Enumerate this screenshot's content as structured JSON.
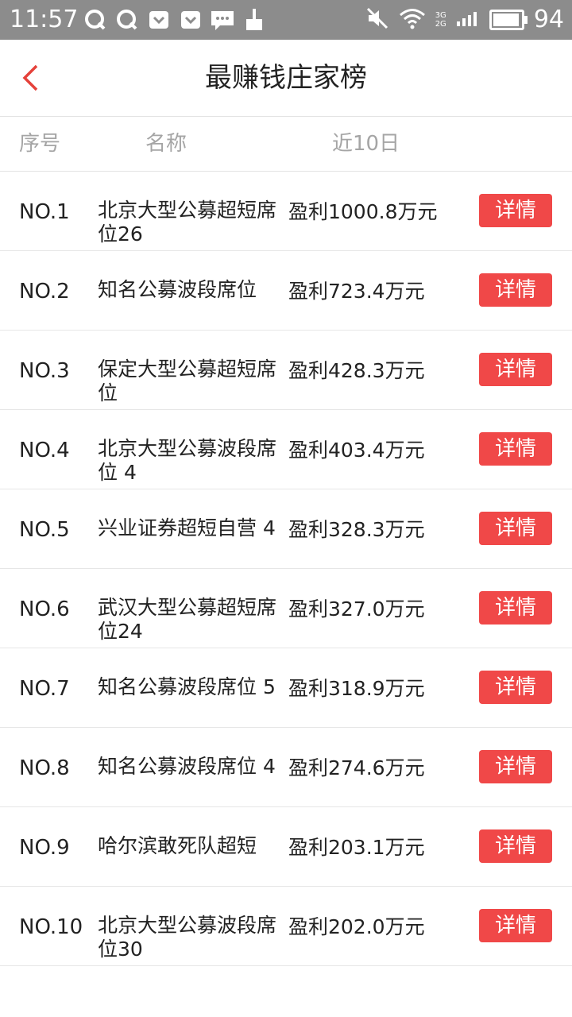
{
  "status_bar": {
    "time": "11:57",
    "battery": "94",
    "icons": [
      "q-app-icon",
      "q-app-icon",
      "pocket-icon",
      "pocket-icon",
      "message-icon",
      "broom-icon"
    ],
    "right_icons": [
      "mute-icon",
      "wifi-icon",
      "signal-icon",
      "battery-icon"
    ],
    "signal_labels": [
      "3G",
      "2G"
    ]
  },
  "header": {
    "title": "最赚钱庄家榜",
    "back_icon": "back-chevron-icon",
    "accent_color": "#e5413a"
  },
  "columns": {
    "rank": "序号",
    "name": "名称",
    "profit": "近10日"
  },
  "rows": [
    {
      "rank": "NO.1",
      "name": "北京大型公募超短席位26",
      "profit": "盈利1000.8万元",
      "button": "详情"
    },
    {
      "rank": "NO.2",
      "name": "知名公募波段席位",
      "profit": "盈利723.4万元",
      "button": "详情"
    },
    {
      "rank": "NO.3",
      "name": "保定大型公募超短席位",
      "profit": "盈利428.3万元",
      "button": "详情"
    },
    {
      "rank": "NO.4",
      "name": "北京大型公募波段席位 4",
      "profit": "盈利403.4万元",
      "button": "详情"
    },
    {
      "rank": "NO.5",
      "name": "兴业证券超短自营 4",
      "profit": "盈利328.3万元",
      "button": "详情"
    },
    {
      "rank": "NO.6",
      "name": "武汉大型公募超短席位24",
      "profit": "盈利327.0万元",
      "button": "详情"
    },
    {
      "rank": "NO.7",
      "name": "知名公募波段席位 5",
      "profit": "盈利318.9万元",
      "button": "详情"
    },
    {
      "rank": "NO.8",
      "name": "知名公募波段席位 4",
      "profit": "盈利274.6万元",
      "button": "详情"
    },
    {
      "rank": "NO.9",
      "name": "哈尔滨敢死队超短",
      "profit": "盈利203.1万元",
      "button": "详情"
    },
    {
      "rank": "NO.10",
      "name": "北京大型公募波段席位30",
      "profit": "盈利202.0万元",
      "button": "详情"
    }
  ],
  "colors": {
    "button_bg": "#f04848",
    "header_text": "#a5a5a5",
    "status_bar_bg": "#8c8c8c"
  }
}
